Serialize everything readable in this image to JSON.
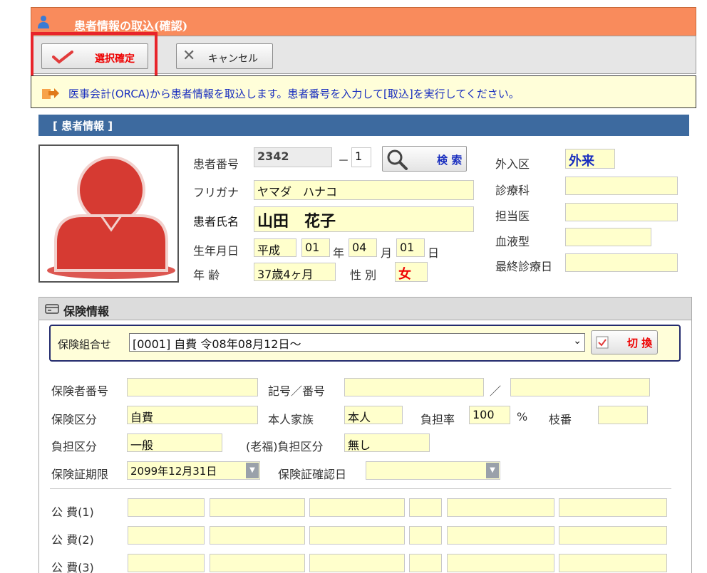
{
  "window": {
    "title": "患者情報の取込(確認)"
  },
  "toolbar": {
    "confirm_label": "選択確定",
    "cancel_label": "キャンセル"
  },
  "info": {
    "message": "医事会計(ORCA)から患者情報を取込します。患者番号を入力して[取込]を実行してください。"
  },
  "patient_section": {
    "title": "[ 患者情報 ]"
  },
  "patient": {
    "number_label": "患者番号",
    "number": "2342",
    "number_sep": "－",
    "branch": "1",
    "search_label": "検 索",
    "furigana_label": "フリガナ",
    "furigana": "ヤマダ　ハナコ",
    "name_label": "患者氏名",
    "name": "山田　花子",
    "birth_label": "生年月日",
    "era": "平成",
    "birth_year": "01",
    "year_unit": "年",
    "birth_month": "04",
    "month_unit": "月",
    "birth_day": "01",
    "day_unit": "日",
    "age_label": "年 齢",
    "age": "37歳4ヶ月",
    "sex_label": "性 別",
    "sex": "女",
    "inout_label": "外入区",
    "inout": "外来",
    "dept_label": "診療科",
    "dept": "",
    "doctor_label": "担当医",
    "doctor": "",
    "blood_label": "血液型",
    "blood": "",
    "last_visit_label": "最終診療日",
    "last_visit": ""
  },
  "insurance": {
    "title": "保険情報",
    "combo_label": "保険組合せ",
    "combo_value": "[0001] 自費 令08年08月12日～",
    "switch_label": "切 換",
    "insurer_no_label": "保険者番号",
    "insurer_no": "",
    "symbol_label": "記号／番号",
    "symbol": "",
    "slash": "／",
    "number": "",
    "kind_label": "保険区分",
    "kind": "自費",
    "family_label": "本人家族",
    "family": "本人",
    "rate_label": "負担率",
    "rate": "100",
    "rate_unit": "%",
    "branch_label": "枝番",
    "branch": "",
    "burden_label": "負担区分",
    "burden": "一般",
    "elder_label": "(老福)負担区分",
    "elder": "無し",
    "expiry_label": "保険証期限",
    "expiry": "2099年12月31日",
    "confirm_date_label": "保険証確認日",
    "confirm_date": "",
    "public_labels": [
      "公 費(1)",
      "公 費(2)",
      "公 費(3)"
    ]
  },
  "colors": {
    "title_bar": "#f98b5c",
    "section_header": "#3d6a9f",
    "field_bg": "#ffffcc",
    "accent_red": "#e00000",
    "accent_blue": "#1a2fbf"
  }
}
